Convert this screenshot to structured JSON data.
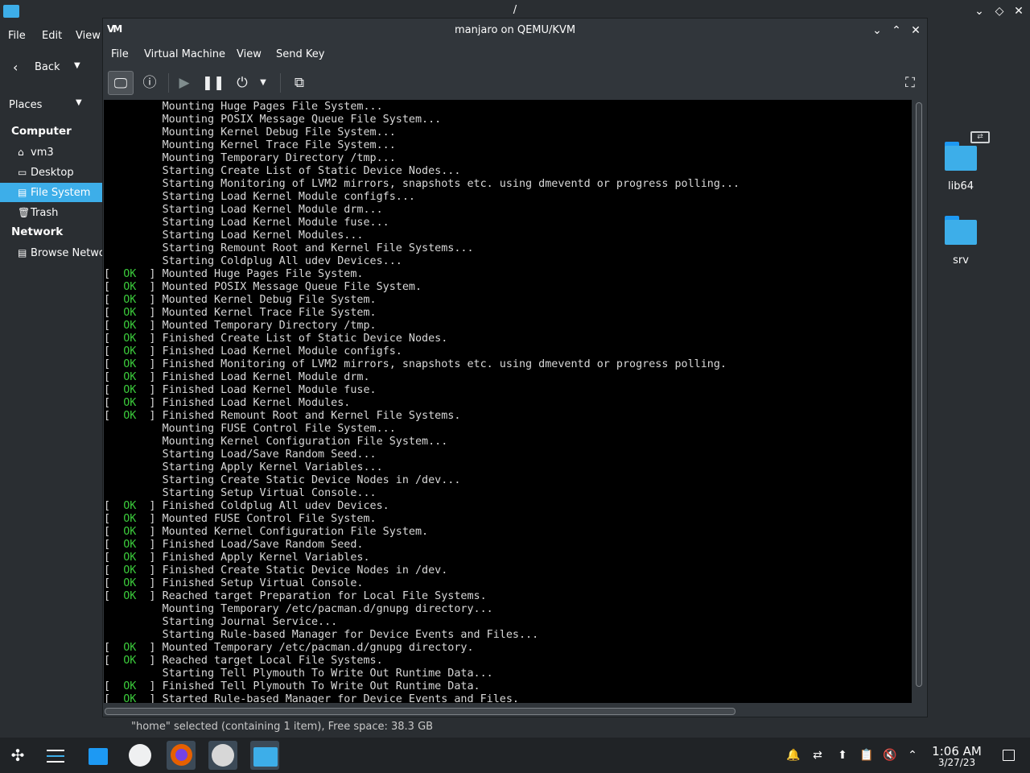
{
  "filemanager": {
    "title": "/",
    "menu": [
      "File",
      "Edit",
      "View"
    ],
    "back_label": "Back",
    "places_label": "Places",
    "sidebar": {
      "sections": [
        {
          "label": "Computer",
          "items": [
            {
              "label": "vm3",
              "icon": "home-icon"
            },
            {
              "label": "Desktop",
              "icon": "desktop-icon"
            },
            {
              "label": "File System",
              "icon": "drive-icon",
              "selected": true
            },
            {
              "label": "Trash",
              "icon": "trash-icon"
            }
          ]
        },
        {
          "label": "Network",
          "items": [
            {
              "label": "Browse Network",
              "icon": "network-icon"
            }
          ]
        }
      ]
    },
    "folders": [
      {
        "label": "lib64",
        "symlink": true
      },
      {
        "label": "srv"
      }
    ],
    "status": "\"home\" selected (containing 1 item), Free space: 38.3 GB"
  },
  "vm": {
    "title": "manjaro on QEMU/KVM",
    "logo": "VM",
    "menu": [
      "File",
      "Virtual Machine",
      "View",
      "Send Key"
    ],
    "toolbar": [
      "console-view-icon",
      "details-icon",
      "run-icon",
      "pause-icon",
      "power-icon",
      "dropdown-icon",
      "snapshots-icon",
      "fullscreen-icon"
    ],
    "ok_label": "OK",
    "console_lines": [
      {
        "ok": false,
        "text": "Mounting Huge Pages File System..."
      },
      {
        "ok": false,
        "text": "Mounting POSIX Message Queue File System..."
      },
      {
        "ok": false,
        "text": "Mounting Kernel Debug File System..."
      },
      {
        "ok": false,
        "text": "Mounting Kernel Trace File System..."
      },
      {
        "ok": false,
        "text": "Mounting Temporary Directory /tmp..."
      },
      {
        "ok": false,
        "text": "Starting Create List of Static Device Nodes..."
      },
      {
        "ok": false,
        "text": "Starting Monitoring of LVM2 mirrors, snapshots etc. using dmeventd or progress polling..."
      },
      {
        "ok": false,
        "text": "Starting Load Kernel Module configfs..."
      },
      {
        "ok": false,
        "text": "Starting Load Kernel Module drm..."
      },
      {
        "ok": false,
        "text": "Starting Load Kernel Module fuse..."
      },
      {
        "ok": false,
        "text": "Starting Load Kernel Modules..."
      },
      {
        "ok": false,
        "text": "Starting Remount Root and Kernel File Systems..."
      },
      {
        "ok": false,
        "text": "Starting Coldplug All udev Devices..."
      },
      {
        "ok": true,
        "text": "Mounted Huge Pages File System."
      },
      {
        "ok": true,
        "text": "Mounted POSIX Message Queue File System."
      },
      {
        "ok": true,
        "text": "Mounted Kernel Debug File System."
      },
      {
        "ok": true,
        "text": "Mounted Kernel Trace File System."
      },
      {
        "ok": true,
        "text": "Mounted Temporary Directory /tmp."
      },
      {
        "ok": true,
        "text": "Finished Create List of Static Device Nodes."
      },
      {
        "ok": true,
        "text": "Finished Load Kernel Module configfs."
      },
      {
        "ok": true,
        "text": "Finished Monitoring of LVM2 mirrors, snapshots etc. using dmeventd or progress polling."
      },
      {
        "ok": true,
        "text": "Finished Load Kernel Module drm."
      },
      {
        "ok": true,
        "text": "Finished Load Kernel Module fuse."
      },
      {
        "ok": true,
        "text": "Finished Load Kernel Modules."
      },
      {
        "ok": true,
        "text": "Finished Remount Root and Kernel File Systems."
      },
      {
        "ok": false,
        "text": "Mounting FUSE Control File System..."
      },
      {
        "ok": false,
        "text": "Mounting Kernel Configuration File System..."
      },
      {
        "ok": false,
        "text": "Starting Load/Save Random Seed..."
      },
      {
        "ok": false,
        "text": "Starting Apply Kernel Variables..."
      },
      {
        "ok": false,
        "text": "Starting Create Static Device Nodes in /dev..."
      },
      {
        "ok": false,
        "text": "Starting Setup Virtual Console..."
      },
      {
        "ok": true,
        "text": "Finished Coldplug All udev Devices."
      },
      {
        "ok": true,
        "text": "Mounted FUSE Control File System."
      },
      {
        "ok": true,
        "text": "Mounted Kernel Configuration File System."
      },
      {
        "ok": true,
        "text": "Finished Load/Save Random Seed."
      },
      {
        "ok": true,
        "text": "Finished Apply Kernel Variables."
      },
      {
        "ok": true,
        "text": "Finished Create Static Device Nodes in /dev."
      },
      {
        "ok": true,
        "text": "Finished Setup Virtual Console."
      },
      {
        "ok": true,
        "text": "Reached target Preparation for Local File Systems."
      },
      {
        "ok": false,
        "text": "Mounting Temporary /etc/pacman.d/gnupg directory..."
      },
      {
        "ok": false,
        "text": "Starting Journal Service..."
      },
      {
        "ok": false,
        "text": "Starting Rule-based Manager for Device Events and Files..."
      },
      {
        "ok": true,
        "text": "Mounted Temporary /etc/pacman.d/gnupg directory."
      },
      {
        "ok": true,
        "text": "Reached target Local File Systems."
      },
      {
        "ok": false,
        "text": "Starting Tell Plymouth To Write Out Runtime Data..."
      },
      {
        "ok": true,
        "text": "Finished Tell Plymouth To Write Out Runtime Data."
      },
      {
        "ok": true,
        "text": "Started Rule-based Manager for Device Events and Files."
      }
    ]
  },
  "taskbar": {
    "apps": [
      "app-launcher-icon",
      "settings-icon",
      "discover-store-icon",
      "kdeconnect-icon",
      "firefox-icon",
      "virt-manager-icon",
      "dolphin-icon"
    ],
    "tray": [
      "notifications-icon",
      "network-icon",
      "updates-icon",
      "clipboard-icon",
      "volume-muted-icon",
      "tray-expand-icon"
    ],
    "clock_time": "1:06 AM",
    "clock_date": "3/27/23"
  },
  "colors": {
    "accent": "#3daee9",
    "ok_green": "#3bcb3b",
    "console_bg": "#000000",
    "window_bg": "#31363b"
  }
}
